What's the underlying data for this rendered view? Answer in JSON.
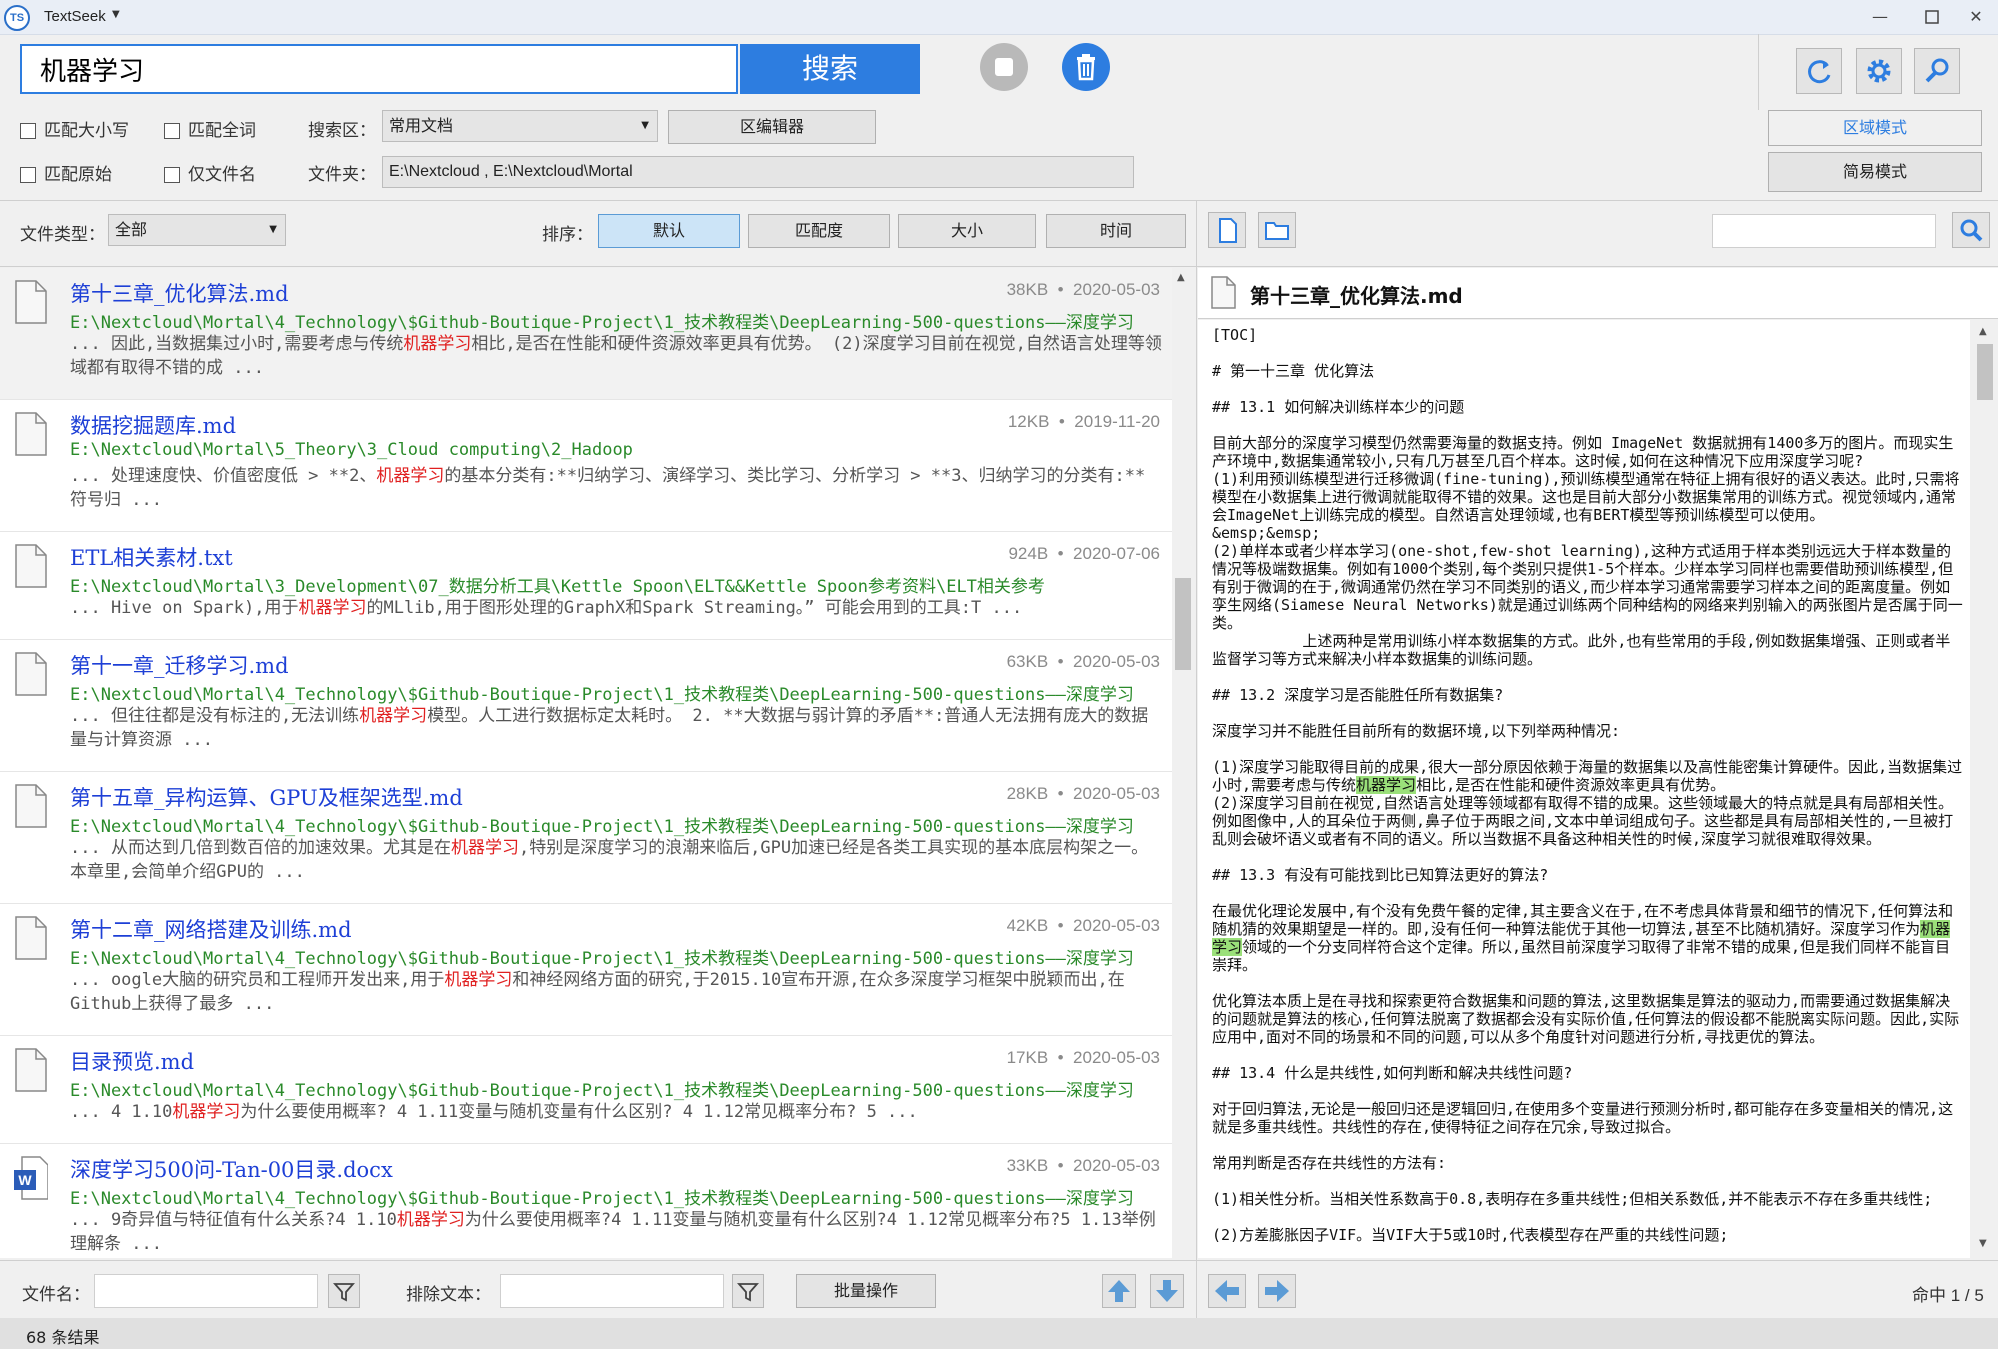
{
  "app": {
    "logo": "TS",
    "title": "TextSeek"
  },
  "search": {
    "query": "机器学习",
    "button_label": "搜索"
  },
  "options": {
    "match_case": "匹配大小写",
    "whole_word": "匹配全词",
    "match_raw": "匹配原始",
    "filename_only": "仅文件名"
  },
  "area": {
    "label": "搜索区：",
    "value": "常用文档",
    "editor_button": "区编辑器",
    "folder_label": "文件夹：",
    "folder_value": "E:\\Nextcloud , E:\\Nextcloud\\Mortal"
  },
  "modes": {
    "area_mode": "区域模式",
    "simple_mode": "简易模式"
  },
  "filter": {
    "type_label": "文件类型：",
    "type_value": "全部",
    "sort_label": "排序：",
    "sort_default": "默认",
    "sort_match": "匹配度",
    "sort_size": "大小",
    "sort_time": "时间"
  },
  "results": [
    {
      "title": "第十三章_优化算法.md",
      "size": "38KB",
      "date": "2020-05-03",
      "path": "E:\\Nextcloud\\Mortal\\4_Technology\\$Github-Boutique-Project\\1_技术教程类\\DeepLearning-500-questions——深度学习",
      "pre": "... 因此,当数据集过小时,需要考虑与传统",
      "hit": "机器学习",
      "post": "相比,是否在性能和硬件资源效率更具有优势。 (2)深度学习目前在视觉,自然语言处理等领域都有取得不错的成 ..."
    },
    {
      "title": "数据挖掘题库.md",
      "size": "12KB",
      "date": "2019-11-20",
      "path": "E:\\Nextcloud\\Mortal\\5_Theory\\3_Cloud computing\\2_Hadoop",
      "pre": "... 处理速度快、价值密度低 > **2、",
      "hit": "机器学习",
      "post": "的基本分类有:**归纳学习、演绎学习、类比学习、分析学习 > **3、归纳学习的分类有:**符号归 ..."
    },
    {
      "title": "ETL相关素材.txt",
      "size": "924B",
      "date": "2020-07-06",
      "path": "E:\\Nextcloud\\Mortal\\3_Development\\07_数据分析工具\\Kettle Spoon\\ELT&&Kettle Spoon参考资料\\ELT相关参考",
      "pre": "... Hive on Spark),用于",
      "hit": "机器学习",
      "post": "的MLlib,用于图形处理的GraphX和Spark Streaming。” 可能会用到的工具:T ..."
    },
    {
      "title": "第十一章_迁移学习.md",
      "size": "63KB",
      "date": "2020-05-03",
      "path": "E:\\Nextcloud\\Mortal\\4_Technology\\$Github-Boutique-Project\\1_技术教程类\\DeepLearning-500-questions——深度学习",
      "pre": "... 但往往都是没有标注的,无法训练",
      "hit": "机器学习",
      "post": "模型。人工进行数据标定太耗时。 2. **大数据与弱计算的矛盾**:普通人无法拥有庞大的数据量与计算资源 ..."
    },
    {
      "title": "第十五章_异构运算、GPU及框架选型.md",
      "size": "28KB",
      "date": "2020-05-03",
      "path": "E:\\Nextcloud\\Mortal\\4_Technology\\$Github-Boutique-Project\\1_技术教程类\\DeepLearning-500-questions——深度学习",
      "pre": "... 从而达到几倍到数百倍的加速效果。尤其是在",
      "hit": "机器学习",
      "post": ",特别是深度学习的浪潮来临后,GPU加速已经是各类工具实现的基本底层构架之一。本章里,会简单介绍GPU的 ..."
    },
    {
      "title": "第十二章_网络搭建及训练.md",
      "size": "42KB",
      "date": "2020-05-03",
      "path": "E:\\Nextcloud\\Mortal\\4_Technology\\$Github-Boutique-Project\\1_技术教程类\\DeepLearning-500-questions——深度学习",
      "pre": "... oogle大脑的研究员和工程师开发出来,用于",
      "hit": "机器学习",
      "post": "和神经网络方面的研究,于2015.10宣布开源,在众多深度学习框架中脱颖而出,在Github上获得了最多 ..."
    },
    {
      "title": "目录预览.md",
      "size": "17KB",
      "date": "2020-05-03",
      "path": "E:\\Nextcloud\\Mortal\\4_Technology\\$Github-Boutique-Project\\1_技术教程类\\DeepLearning-500-questions——深度学习",
      "pre": "... 4 1.10",
      "hit": "机器学习",
      "post": "为什么要使用概率? 4 1.11变量与随机变量有什么区别? 4 1.12常见概率分布? 5 ..."
    },
    {
      "title": "深度学习500问-Tan-00目录.docx",
      "size": "33KB",
      "date": "2020-05-03",
      "path": "E:\\Nextcloud\\Mortal\\4_Technology\\$Github-Boutique-Project\\1_技术教程类\\DeepLearning-500-questions——深度学习",
      "pre": "... 9奇异值与特征值有什么关系?4 1.10",
      "hit": "机器学习",
      "post": "为什么要使用概率?4 1.11变量与随机变量有什么区别?4 1.12常见概率分布?5 1.13举例理解条 ..."
    }
  ],
  "preview": {
    "title": "第十三章_优化算法.md",
    "part1": "[TOC]\n\n# 第一十三章 优化算法\n\n## 13.1 如何解决训练样本少的问题\n\n目前大部分的深度学习模型仍然需要海量的数据支持。例如 ImageNet 数据就拥有1400多万的图片。而现实生产环境中,数据集通常较小,只有几万甚至几百个样本。这时候,如何在这种情况下应用深度学习呢?\n(1)利用预训练模型进行迁移微调(fine-tuning),预训练模型通常在特征上拥有很好的语义表达。此时,只需将模型在小数据集上进行微调就能取得不错的效果。这也是目前大部分小数据集常用的训练方式。视觉领域内,通常会ImageNet上训练完成的模型。自然语言处理领域,也有BERT模型等预训练模型可以使用。\n&emsp;&emsp;\n(2)单样本或者少样本学习(one-shot,few-shot learning),这种方式适用于样本类别远远大于样本数量的情况等极端数据集。例如有1000个类别,每个类别只提供1-5个样本。少样本学习同样也需要借助预训练模型,但有别于微调的在于,微调通常仍然在学习不同类别的语义,而少样本学习通常需要学习样本之间的距离度量。例如孪生网络(Siamese Neural Networks)就是通过训练两个同种结构的网络来判别输入的两张图片是否属于同一类。\n          上述两种是常用训练小样本数据集的方式。此外,也有些常用的手段,例如数据集增强、正则或者半监督学习等方式来解决小样本数据集的训练问题。\n\n## 13.2 深度学习是否能胜任所有数据集?\n\n深度学习并不能胜任目前所有的数据环境,以下列举两种情况:\n\n(1)深度学习能取得目前的成果,很大一部分原因依赖于海量的数据集以及高性能密集计算硬件。因此,当数据集过小时,需要考虑与传统",
    "hit": "机器学习",
    "part2": "相比,是否在性能和硬件资源效率更具有优势。\n(2)深度学习目前在视觉,自然语言处理等领域都有取得不错的成果。这些领域最大的特点就是具有局部相关性。例如图像中,人的耳朵位于两侧,鼻子位于两眼之间,文本中单词组成句子。这些都是具有局部相关性的,一旦被打乱则会破坏语义或者有不同的语义。所以当数据不具备这种相关性的时候,深度学习就很难取得效果。\n\n## 13.3 有没有可能找到比已知算法更好的算法?\n\n在最优化理论发展中,有个没有免费午餐的定律,其主要含义在于,在不考虑具体背景和细节的情况下,任何算法和随机猜的效果期望是一样的。即,没有任何一种算法能优于其他一切算法,甚至不比随机猜好。深度学习作为",
    "hit2": "机器学习",
    "part3": "领域的一个分支同样符合这个定律。所以,虽然目前深度学习取得了非常不错的成果,但是我们同样不能盲目崇拜。\n\n优化算法本质上是在寻找和探索更符合数据集和问题的算法,这里数据集是算法的驱动力,而需要通过数据集解决的问题就是算法的核心,任何算法脱离了数据都会没有实际价值,任何算法的假设都不能脱离实际问题。因此,实际应用中,面对不同的场景和不同的问题,可以从多个角度针对问题进行分析,寻找更优的算法。\n\n## 13.4 什么是共线性,如何判断和解决共线性问题?\n\n对于回归算法,无论是一般回归还是逻辑回归,在使用多个变量进行预测分析时,都可能存在多变量相关的情况,这就是多重共线性。共线性的存在,使得特征之间存在冗余,导致过拟合。\n\n常用判断是否存在共线性的方法有:\n\n(1)相关性分析。当相关性系数高于0.8,表明存在多重共线性;但相关系数低,并不能表示不存在多重共线性;\n\n(2)方差膨胀因子VIF。当VIF大于5或10时,代表模型存在严重的共线性问题;"
  },
  "bottom": {
    "filename_label": "文件名：",
    "exclude_label": "排除文本：",
    "batch_button": "批量操作",
    "hits": "命中 1 / 5"
  },
  "status": {
    "count": "68 条结果"
  }
}
